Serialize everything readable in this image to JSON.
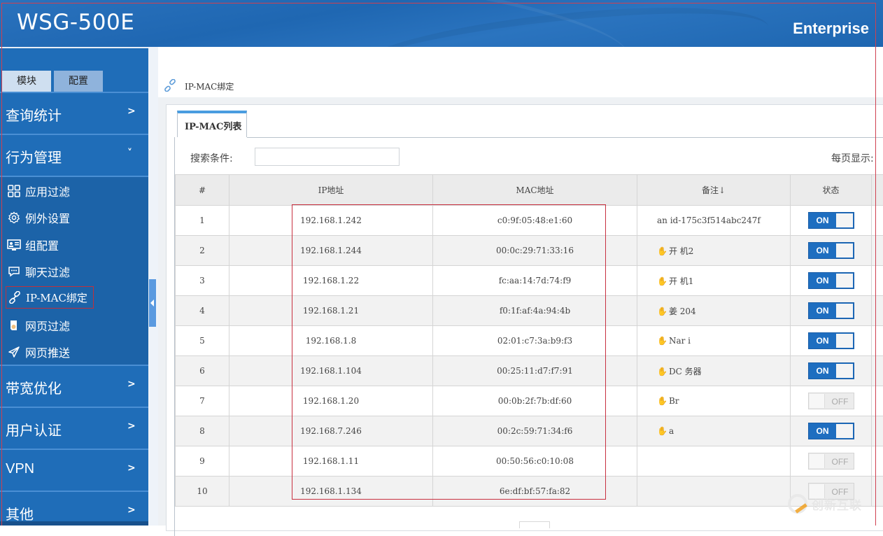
{
  "header": {
    "product": "WSG-500E",
    "edition": "Enterprise"
  },
  "sidebar": {
    "mode_tabs": [
      "模块",
      "配置"
    ],
    "groups": [
      {
        "label": "查询统计",
        "chevron": ">"
      },
      {
        "label": "行为管理",
        "chevron": "˅"
      },
      {
        "label": "带宽优化",
        "chevron": ">"
      },
      {
        "label": "用户认证",
        "chevron": ">"
      },
      {
        "label": "VPN",
        "chevron": ">"
      },
      {
        "label": "其他",
        "chevron": ">"
      }
    ],
    "sub_items": [
      {
        "label": "应用过滤",
        "icon": "grid-icon"
      },
      {
        "label": "例外设置",
        "icon": "gear-icon"
      },
      {
        "label": "组配置",
        "icon": "id-card-icon"
      },
      {
        "label": "聊天过滤",
        "icon": "chat-icon"
      },
      {
        "label": "IP-MAC绑定",
        "icon": "link-icon",
        "active": true
      },
      {
        "label": "网页过滤",
        "icon": "document-icon"
      },
      {
        "label": "网页推送",
        "icon": "send-icon"
      }
    ]
  },
  "breadcrumb": {
    "label": "IP-MAC绑定"
  },
  "panel": {
    "tab_label": "IP-MAC列表",
    "search_label": "搜索条件:",
    "search_value": "",
    "per_page_label": "每页显示:"
  },
  "table": {
    "headers": [
      "#",
      "IP地址",
      "MAC地址",
      "备注↓",
      "状态"
    ],
    "rows": [
      {
        "num": "1",
        "ip": "192.168.1.242",
        "mac": "c0:9f:05:48:e1:60",
        "note": "an      id-175c3f514abc247f",
        "note_icon": false,
        "state": "ON"
      },
      {
        "num": "2",
        "ip": "192.168.1.244",
        "mac": "00:0c:29:71:33:16",
        "note": "开   机2",
        "note_icon": true,
        "state": "ON"
      },
      {
        "num": "3",
        "ip": "192.168.1.22",
        "mac": "fc:aa:14:7d:74:f9",
        "note": "开   机1",
        "note_icon": true,
        "state": "ON"
      },
      {
        "num": "4",
        "ip": "192.168.1.21",
        "mac": "f0:1f:af:4a:94:4b",
        "note": "姜    204",
        "note_icon": true,
        "state": "ON"
      },
      {
        "num": "5",
        "ip": "192.168.1.8",
        "mac": "02:01:c7:3a:b9:f3",
        "note": "Nar   i",
        "note_icon": true,
        "state": "ON"
      },
      {
        "num": "6",
        "ip": "192.168.1.104",
        "mac": "00:25:11:d7:f7:91",
        "note": "DC  务器",
        "note_icon": true,
        "state": "ON"
      },
      {
        "num": "7",
        "ip": "192.168.1.20",
        "mac": "00:0b:2f:7b:df:60",
        "note": "Br   ",
        "note_icon": true,
        "state": "OFF"
      },
      {
        "num": "8",
        "ip": "192.168.7.246",
        "mac": "00:2c:59:71:34:f6",
        "note": "a   ",
        "note_icon": true,
        "state": "ON"
      },
      {
        "num": "9",
        "ip": "192.168.1.11",
        "mac": "00:50:56:c0:10:08",
        "note": "",
        "note_icon": false,
        "state": "OFF"
      },
      {
        "num": "10",
        "ip": "192.168.1.134",
        "mac": "6e:df:bf:57:fa:82",
        "note": "",
        "note_icon": false,
        "state": "OFF"
      }
    ]
  },
  "watermark": "创新互联"
}
